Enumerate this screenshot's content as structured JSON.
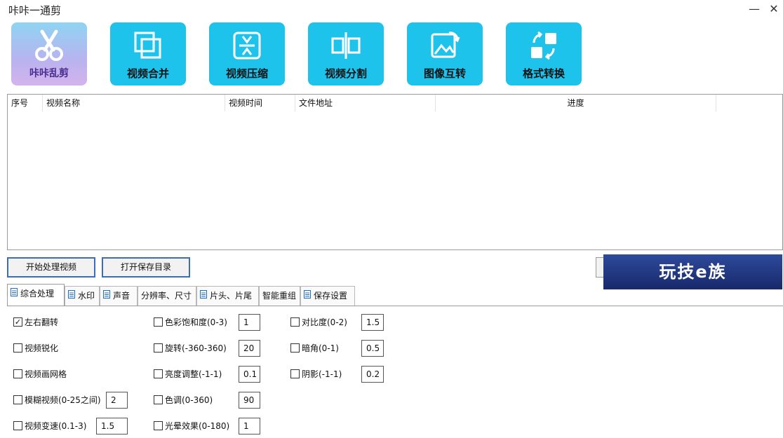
{
  "window": {
    "title": "咔咔一通剪",
    "minimize": "—",
    "close": "✕"
  },
  "toolbar": {
    "logo_label": "咔咔乱剪",
    "merge_label": "视频合并",
    "compress_label": "视频压缩",
    "split_label": "视频分割",
    "image_convert_label": "图像互转",
    "format_convert_label": "格式转换"
  },
  "table": {
    "columns": {
      "index": "序号",
      "name": "视频名称",
      "duration": "视频时间",
      "path": "文件地址",
      "progress": "进度"
    }
  },
  "actions": {
    "start_label": "开始处理视频",
    "open_dir_label": "打开保存目录"
  },
  "banner": {
    "text": "玩技e族"
  },
  "tabs": {
    "general": "综合处理",
    "watermark": "水印",
    "audio": "声音",
    "resolution": "分辨率、尺寸",
    "intro_outro": "片头、片尾",
    "smart_regroup": "智能重组",
    "save_settings": "保存设置"
  },
  "options": {
    "flip": {
      "label": "左右翻转",
      "checked": true
    },
    "sharpen": {
      "label": "视频锐化",
      "checked": false
    },
    "grid": {
      "label": "视频画网格",
      "checked": false
    },
    "blur": {
      "label": "模糊视频(0-25之间)",
      "value": "2"
    },
    "speed": {
      "label": "视频变速(0.1-3)",
      "value": "1.5"
    },
    "saturation": {
      "label": "色彩饱和度(0-3)",
      "value": "1"
    },
    "rotate": {
      "label": "旋转(-360-360)",
      "value": "20"
    },
    "brightness": {
      "label": "亮度调整(-1-1)",
      "value": "0.1"
    },
    "hue": {
      "label": "色调(0-360)",
      "value": "90"
    },
    "halo": {
      "label": "光晕效果(0-180)",
      "value": "1"
    },
    "contrast": {
      "label": "对比度(0-2)",
      "value": "1.5"
    },
    "vignette": {
      "label": "暗角(0-1)",
      "value": "0.5"
    },
    "shadow": {
      "label": "阴影(-1-1)",
      "value": "0.2"
    }
  },
  "check_mark": "✓",
  "colors": {
    "tool_button": "#1ec3ec",
    "button_border": "#3d6fb0",
    "banner": "#1f3580"
  }
}
